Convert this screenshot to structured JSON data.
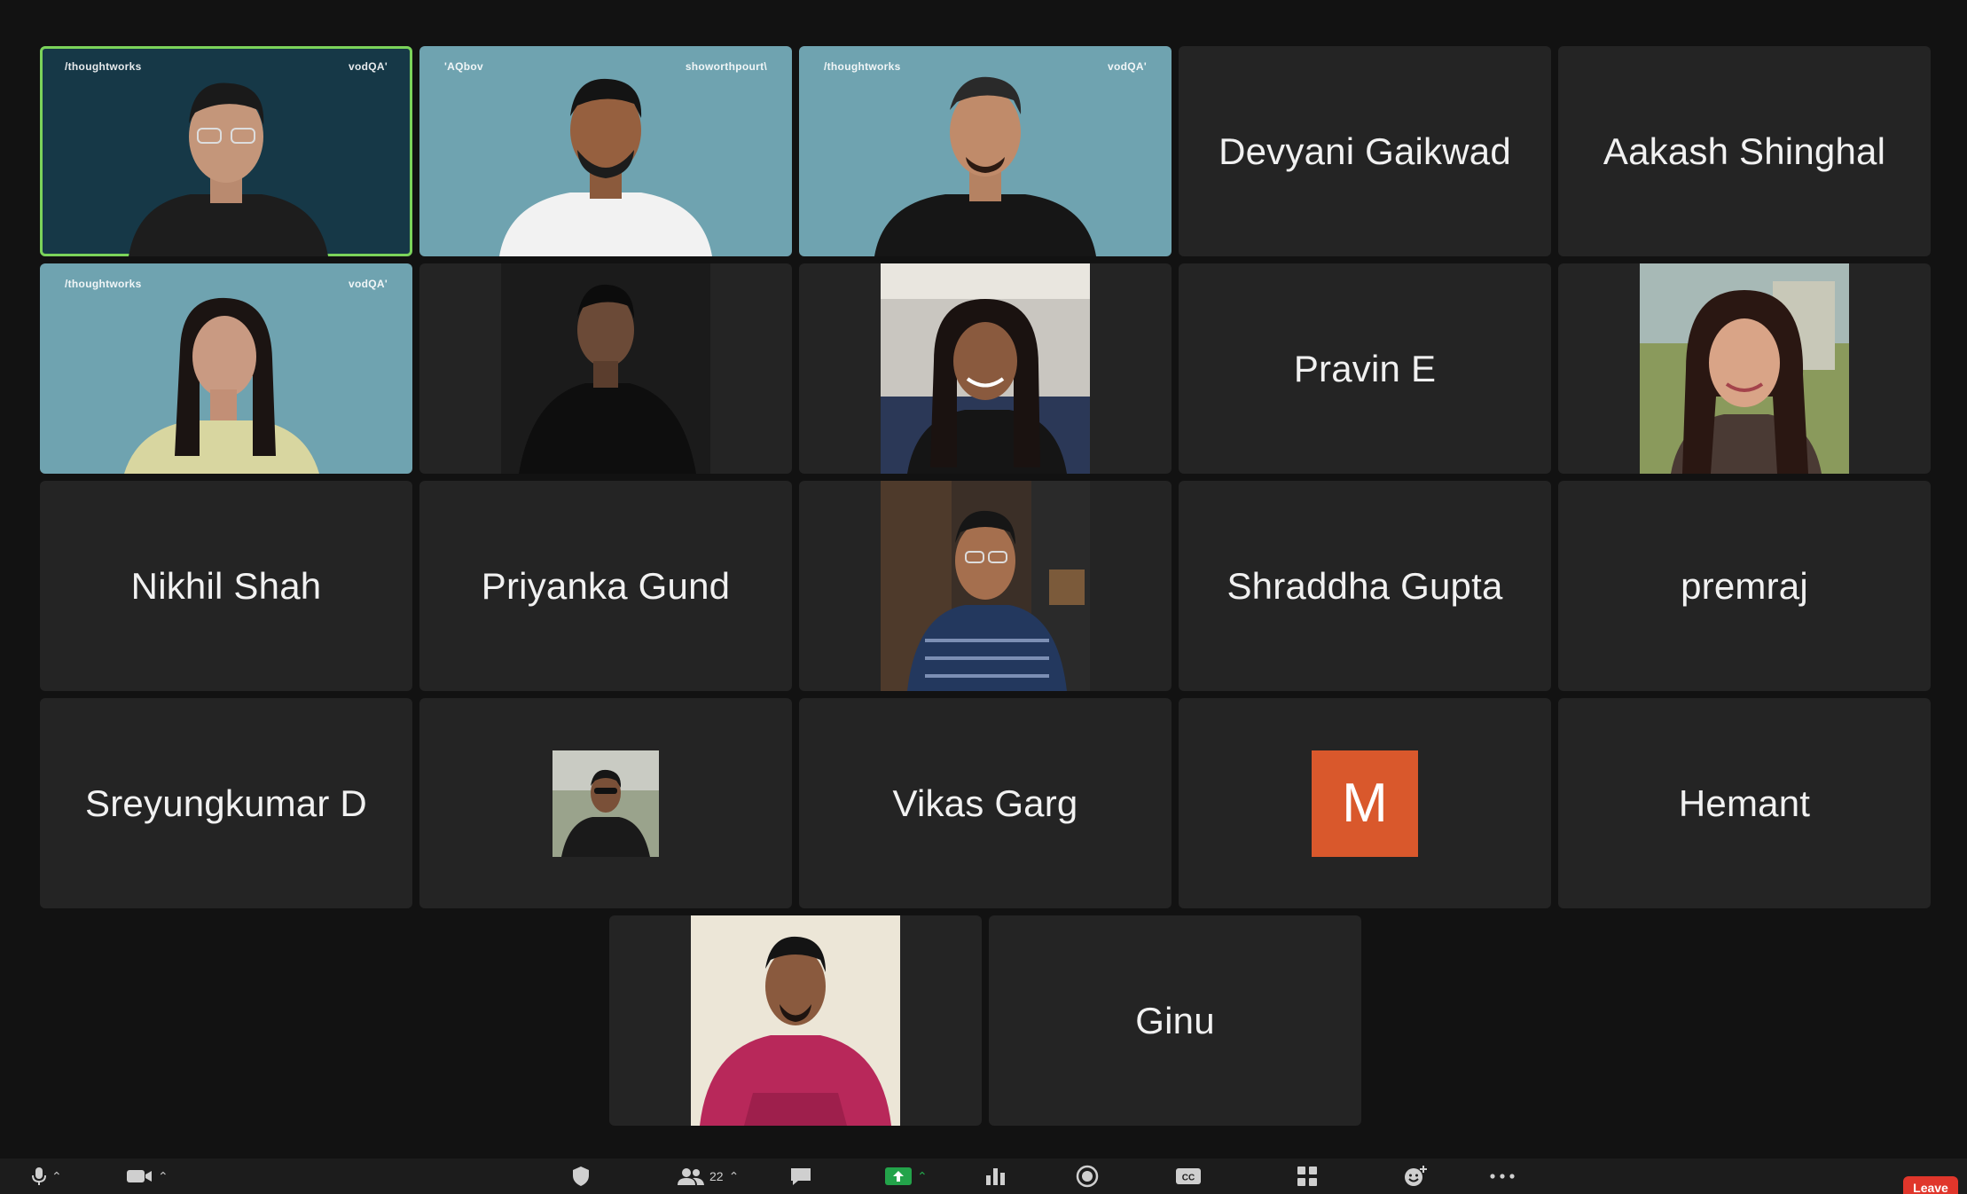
{
  "participants": {
    "p01": {
      "brand_left": "/thoughtworks",
      "brand_right": "vodQA'"
    },
    "p02": {
      "brand_left": "'AQbov",
      "brand_right": "showorthpourt\\"
    },
    "p03": {
      "brand_left": "/thoughtworks",
      "brand_right": "vodQA'"
    },
    "p04": {
      "name": "Devyani Gaikwad"
    },
    "p05": {
      "name": "Aakash Shinghal"
    },
    "p06": {
      "brand_left": "/thoughtworks",
      "brand_right": "vodQA'"
    },
    "p07": {},
    "p08": {},
    "p09": {
      "name": "Pravin E"
    },
    "p10": {},
    "p11": {
      "name": "Nikhil Shah"
    },
    "p12": {
      "name": "Priyanka Gund"
    },
    "p13": {},
    "p14": {
      "name": "Shraddha Gupta"
    },
    "p15": {
      "name": "premraj"
    },
    "p16": {
      "name": "Sreyungkumar D"
    },
    "p17": {},
    "p18": {
      "name": "Vikas Garg"
    },
    "p19": {
      "avatar_letter": "M",
      "avatar_color": "#d9582c"
    },
    "p20": {
      "name": "Hemant"
    },
    "p21": {},
    "p22": {
      "name": "Ginu"
    }
  },
  "toolbar": {
    "participants_count": "22",
    "leave_label": "Leave",
    "colors": {
      "share_green": "#23a34a",
      "leave_red": "#e0362b",
      "active_speaker": "#7bd35a"
    }
  }
}
